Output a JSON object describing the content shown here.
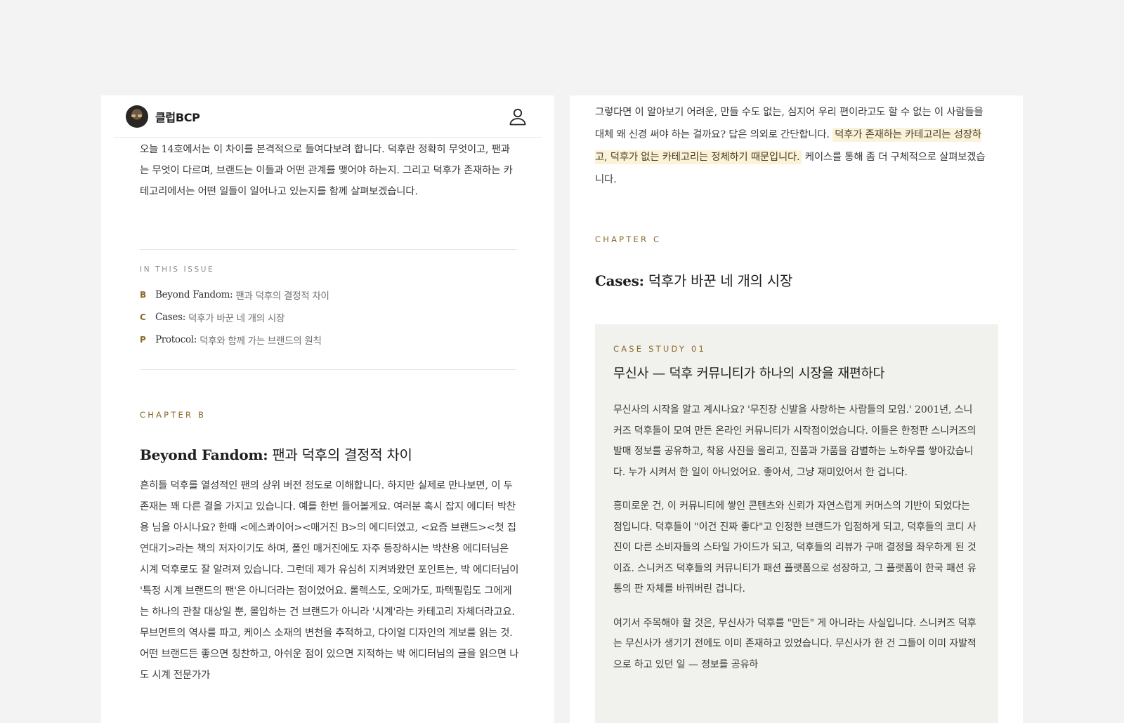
{
  "header": {
    "brand": "클럽BCP"
  },
  "left": {
    "intro": "오늘 14호에서는 이 차이를 본격적으로 들여다보려 합니다. 덕후란 정확히 무엇이고, 팬과는 무엇이 다르며, 브랜드는 이들과 어떤 관계를 맺어야 하는지. 그리고 덕후가 존재하는 카테고리에서는 어떤 일들이 일어나고 있는지를 함께 살펴보겠습니다.",
    "in_this_issue": "IN THIS ISSUE",
    "toc": [
      {
        "key": "B",
        "en": "Beyond Fandom:",
        "ko": "팬과 덕후의 결정적 차이"
      },
      {
        "key": "C",
        "en": "Cases:",
        "ko": "덕후가 바꾼 네 개의 시장"
      },
      {
        "key": "P",
        "en": "Protocol:",
        "ko": "덕후와 함께 가는 브랜드의 원칙"
      }
    ],
    "chapter_label": "CHAPTER B",
    "chapter_title_en": "Beyond Fandom:",
    "chapter_title_ko": "팬과 덕후의 결정적 차이",
    "chapter_body": "흔히들 덕후를 열성적인 팬의 상위 버전 정도로 이해합니다. 하지만 실제로 만나보면, 이 두 존재는 꽤 다른 결을 가지고 있습니다. 예를 한번 들어볼게요. 여러분 혹시 잡지 에디터 박찬용 님을 아시나요? 한때 <에스콰이어><매거진 B>의 에디터였고, <요즘 브랜드><첫 집 연대기>라는 책의 저자이기도 하며, 폴인 매거진에도 자주 등장하시는 박찬용 에디터님은 시계 덕후로도 잘 알려져 있습니다. 그런데 제가 유심히 지켜봐왔던 포인트는, 박 에디터님이 '특정 시계 브랜드의 팬'은 아니더라는 점이었어요. 롤렉스도, 오메가도, 파텍필립도 그에게는 하나의 관찰 대상일 뿐, 몰입하는 건 브랜드가 아니라 '시계'라는 카테고리 자체더라고요. 무브먼트의 역사를 파고, 케이스 소재의 변천을 추적하고, 다이얼 디자인의 계보를 읽는 것. 어떤 브랜드든 좋으면 칭찬하고, 아쉬운 점이 있으면 지적하는 박 에디터님의 글을 읽으면 나도 시계 전문가가"
  },
  "right": {
    "intro_plain": "그렇다면 이 알아보기 어려운, 만들 수도 없는, 심지어 우리 편이라고도 할 수 없는 이 사람들을 대체 왜 신경 써야 하는 걸까요? 답은 의외로 간단합니다.",
    "intro_highlight": "덕후가 존재하는 카테고리는 성장하고, 덕후가 없는 카테고리는 정체하기 때문입니다.",
    "intro_tail": "케이스를 통해 좀 더 구체적으로 살펴보겠습니다.",
    "chapter_label": "CHAPTER C",
    "chapter_title_en": "Cases:",
    "chapter_title_ko": "덕후가 바꾼 네 개의 시장",
    "case": {
      "label": "CASE STUDY 01",
      "title": "무신사 — 덕후 커뮤니티가 하나의 시장을 재편하다",
      "p1": "무신사의 시작을 알고 계시나요? '무진장 신발을 사랑하는 사람들의 모임.' 2001년, 스니커즈 덕후들이 모여 만든 온라인 커뮤니티가 시작점이었습니다. 이들은 한정판 스니커즈의 발매 정보를 공유하고, 착용 사진을 올리고, 진품과 가품을 감별하는 노하우를 쌓아갔습니다. 누가 시켜서 한 일이 아니었어요. 좋아서, 그냥 재미있어서 한 겁니다.",
      "p2": "흥미로운 건, 이 커뮤니티에 쌓인 콘텐츠와 신뢰가 자연스럽게 커머스의 기반이 되었다는 점입니다. 덕후들이 \"이건 진짜 좋다\"고 인정한 브랜드가 입점하게 되고, 덕후들의 코디 사진이 다른 소비자들의 스타일 가이드가 되고, 덕후들의 리뷰가 구매 결정을 좌우하게 된 것이죠. 스니커즈 덕후들의 커뮤니티가 패션 플랫폼으로 성장하고, 그 플랫폼이 한국 패션 유통의 판 자체를 바꿔버린 겁니다.",
      "p3": "여기서 주목해야 할 것은, 무신사가 덕후를 \"만든\" 게 아니라는 사실입니다. 스니커즈 덕후는 무신사가 생기기 전에도 이미 존재하고 있었습니다. 무신사가 한 건 그들이 이미 자발적으로 하고 있던 일 — 정보를 공유하"
    }
  }
}
